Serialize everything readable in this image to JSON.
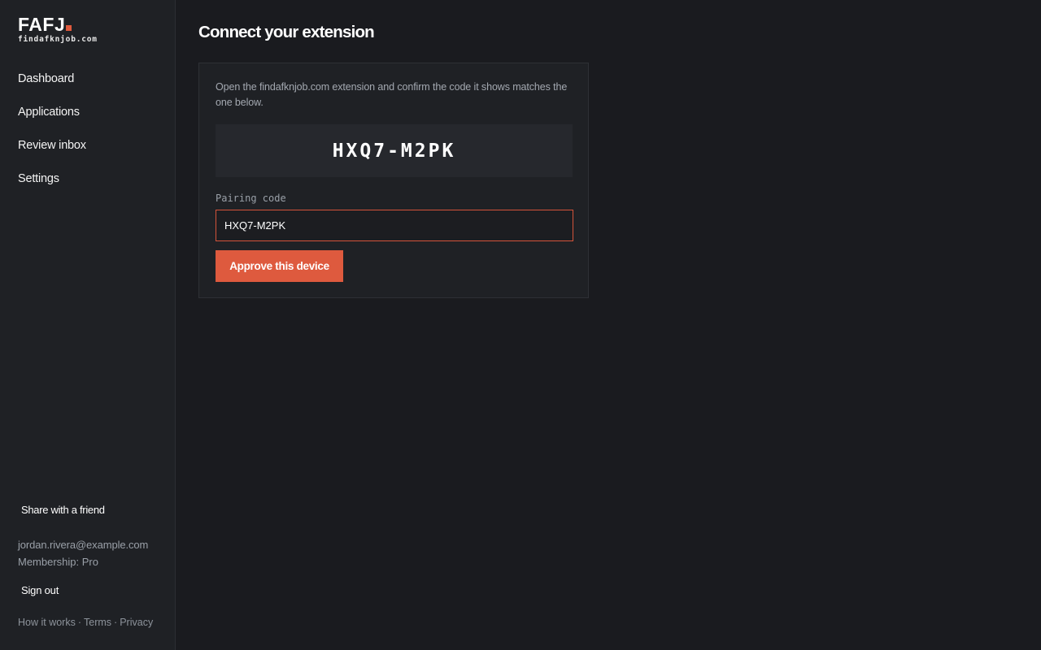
{
  "brand": {
    "name": "FAFJ",
    "domain": "findafknjob.com",
    "accent_color": "#e05a3d"
  },
  "sidebar": {
    "nav": [
      {
        "label": "Dashboard"
      },
      {
        "label": "Applications"
      },
      {
        "label": "Review inbox"
      },
      {
        "label": "Settings"
      }
    ],
    "share_label": "Share with a friend",
    "user": {
      "email": "jordan.rivera@example.com",
      "membership": "Membership: Pro"
    },
    "signout_label": "Sign out",
    "footer": {
      "how_it_works": "How it works",
      "terms": "Terms",
      "privacy": "Privacy",
      "separator": "·"
    }
  },
  "main": {
    "title": "Connect your extension",
    "card": {
      "description": "Open the findafknjob.com extension and confirm the code it shows matches the one below.",
      "code": "HXQ7-M2PK",
      "field_label": "Pairing code",
      "input_value": "HXQ7-M2PK",
      "button_label": "Approve this device"
    }
  }
}
